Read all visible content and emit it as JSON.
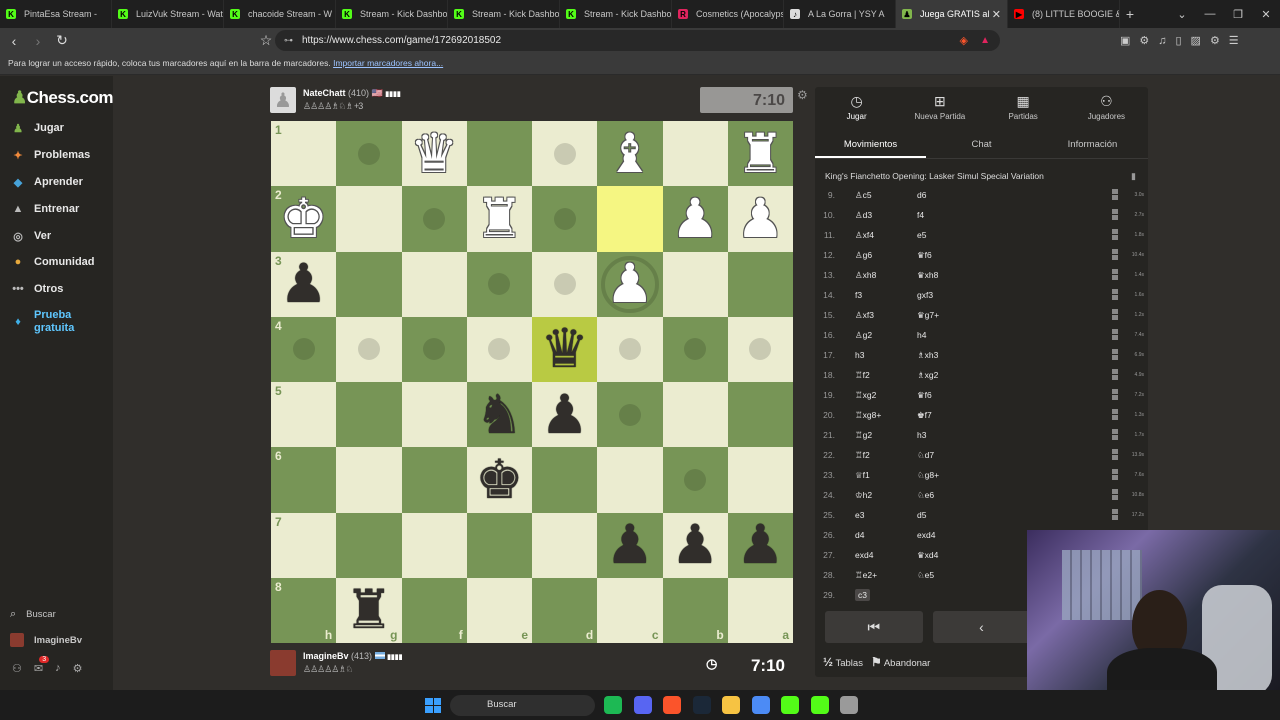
{
  "browser": {
    "tabs": [
      {
        "title": "PintaEsa Stream - ",
        "color": "#53fc18",
        "glyph": "K"
      },
      {
        "title": "LuizVuk Stream - Wat",
        "color": "#53fc18",
        "glyph": "K"
      },
      {
        "title": "chacoide Stream - W",
        "color": "#53fc18",
        "glyph": "K"
      },
      {
        "title": "Stream - Kick Dashbo",
        "color": "#53fc18",
        "glyph": "K"
      },
      {
        "title": "Stream - Kick Dashbo",
        "color": "#53fc18",
        "glyph": "K"
      },
      {
        "title": "Stream - Kick Dashbo",
        "color": "#53fc18",
        "glyph": "K"
      },
      {
        "title": "Cosmetics (Apocalyps",
        "color": "#e0245e",
        "glyph": "R"
      },
      {
        "title": "A La Gorra | YSY A",
        "color": "#dddddd",
        "glyph": "♪"
      },
      {
        "title": "Juega GRATIS al",
        "color": "#81b64c",
        "glyph": "♟",
        "active": true
      },
      {
        "title": "(8) LITTLE BOOGIE &",
        "color": "#ff0000",
        "glyph": "▶"
      }
    ],
    "url": "https://www.chess.com/game/172692018502",
    "bookmarks_text": "Para lograr un acceso rápido, coloca tus marcadores aquí en la barra de marcadores.",
    "bookmarks_link": "Importar marcadores ahora..."
  },
  "sidebar": {
    "logo": "Chess.com",
    "items": [
      {
        "label": "Jugar",
        "icon": "♟",
        "color": "#81b64c"
      },
      {
        "label": "Problemas",
        "icon": "✦",
        "color": "#f08a3c"
      },
      {
        "label": "Aprender",
        "icon": "◆",
        "color": "#47a3d9"
      },
      {
        "label": "Entrenar",
        "icon": "▲",
        "color": "#bbbbbb"
      },
      {
        "label": "Ver",
        "icon": "◎",
        "color": "#bbbbbb"
      },
      {
        "label": "Comunidad",
        "icon": "●",
        "color": "#e7a93c"
      },
      {
        "label": "Otros",
        "icon": "•••",
        "color": "#bbbbbb"
      },
      {
        "label": "Prueba gratuita",
        "icon": "♦",
        "color": "#3fb0e8"
      }
    ],
    "search": "Buscar",
    "user": "ImagineBv",
    "notif_count": "3"
  },
  "game": {
    "top_player": {
      "name": "NateChatt",
      "rating": "(410)",
      "flags": "🇺🇸",
      "captured": "♙♙♙♙♗♘♗ +3",
      "clock": "7:10"
    },
    "bottom_player": {
      "name": "ImagineBv",
      "rating": "(413)",
      "captured": "♙♙♙♙♙♗♘",
      "clock": "7:10"
    },
    "files": [
      "h",
      "g",
      "f",
      "e",
      "d",
      "c",
      "b",
      "a"
    ],
    "ranks": [
      "1",
      "2",
      "3",
      "4",
      "5",
      "6",
      "7",
      "8"
    ],
    "board": [
      [
        "",
        "",
        "wQ",
        "",
        "",
        "wB",
        "",
        "wR"
      ],
      [
        "wK",
        "",
        "",
        "wR",
        "",
        "",
        "wP",
        "wP"
      ],
      [
        "bP",
        "",
        "",
        "",
        "",
        "wP",
        "",
        ""
      ],
      [
        "",
        "",
        "",
        "",
        "bQ",
        "",
        "",
        ""
      ],
      [
        "",
        "",
        "",
        "bN",
        "bP",
        "",
        "",
        ""
      ],
      [
        "",
        "",
        "",
        "bK",
        "",
        "",
        "",
        ""
      ],
      [
        "",
        "",
        "",
        "",
        "",
        "bP",
        "bP",
        "bP"
      ],
      [
        "",
        "bR",
        "",
        "",
        "",
        "",
        "",
        ""
      ]
    ],
    "highlights": [
      [
        1,
        5
      ],
      [
        3,
        4
      ]
    ],
    "dots": [
      [
        0,
        1
      ],
      [
        0,
        4
      ],
      [
        1,
        2
      ],
      [
        1,
        4
      ],
      [
        2,
        3
      ],
      [
        2,
        4
      ],
      [
        3,
        0
      ],
      [
        3,
        1
      ],
      [
        3,
        2
      ],
      [
        3,
        3
      ],
      [
        3,
        5
      ],
      [
        3,
        6
      ],
      [
        3,
        7
      ],
      [
        4,
        5
      ],
      [
        5,
        6
      ]
    ],
    "rings": [
      [
        2,
        5
      ]
    ]
  },
  "panel": {
    "tabs": [
      {
        "label": "Jugar",
        "icon": "◷",
        "active": true
      },
      {
        "label": "Nueva Partida",
        "icon": "⊞"
      },
      {
        "label": "Partidas",
        "icon": "▦"
      },
      {
        "label": "Jugadores",
        "icon": "⚇"
      }
    ],
    "subtabs": [
      {
        "label": "Movimientos",
        "active": true
      },
      {
        "label": "Chat"
      },
      {
        "label": "Información"
      }
    ],
    "opening": "King's Fianchetto Opening: Lasker Simul Special Variation",
    "moves": [
      {
        "n": "9.",
        "w": "♙c5",
        "b": "d6",
        "tw": "3.0s"
      },
      {
        "n": "10.",
        "w": "♙d3",
        "b": "f4",
        "tw": "2.7s"
      },
      {
        "n": "11.",
        "w": "♙xf4",
        "b": "e5",
        "tw": "1.8s"
      },
      {
        "n": "12.",
        "w": "♙g6",
        "b": "♛f6",
        "tw": "10.4s"
      },
      {
        "n": "13.",
        "w": "♙xh8",
        "b": "♛xh8",
        "tw": "1.4s"
      },
      {
        "n": "14.",
        "w": "f3",
        "b": "gxf3",
        "tw": "1.6s"
      },
      {
        "n": "15.",
        "w": "♙xf3",
        "b": "♛g7+",
        "tw": "1.2s"
      },
      {
        "n": "16.",
        "w": "♙g2",
        "b": "h4",
        "tw": "7.4s"
      },
      {
        "n": "17.",
        "w": "h3",
        "b": "♗xh3",
        "tw": "6.9s"
      },
      {
        "n": "18.",
        "w": "♖f2",
        "b": "♗xg2",
        "tw": "4.9s"
      },
      {
        "n": "19.",
        "w": "♖xg2",
        "b": "♛f6",
        "tw": "7.2s"
      },
      {
        "n": "20.",
        "w": "♖xg8+",
        "b": "♚f7",
        "tw": "1.3s"
      },
      {
        "n": "21.",
        "w": "♖g2",
        "b": "h3",
        "tw": "1.7s"
      },
      {
        "n": "22.",
        "w": "♖f2",
        "b": "♘d7",
        "tw": "13.9s"
      },
      {
        "n": "23.",
        "w": "♕f1",
        "b": "♘g8+",
        "tw": "7.6s"
      },
      {
        "n": "24.",
        "w": "♔h2",
        "b": "♘e6",
        "tw": "10.8s"
      },
      {
        "n": "25.",
        "w": "e3",
        "b": "d5",
        "tw": "17.2s"
      },
      {
        "n": "26.",
        "w": "d4",
        "b": "exd4",
        "tw": ""
      },
      {
        "n": "27.",
        "w": "exd4",
        "b": "♛xd4",
        "tw": ""
      },
      {
        "n": "28.",
        "w": "♖e2+",
        "b": "♘e5",
        "tw": ""
      },
      {
        "n": "29.",
        "w": "c3",
        "b": "",
        "tw": "",
        "current": true
      }
    ],
    "controls": [
      "⏮",
      "‹",
      "▶"
    ],
    "draw": "Tablas",
    "draw_icon": "½",
    "resign": "Abandonar",
    "resign_icon": "⚑"
  },
  "taskbar": {
    "search": "Buscar",
    "apps": [
      {
        "name": "spotify",
        "color": "#1db954"
      },
      {
        "name": "discord",
        "color": "#5865f2"
      },
      {
        "name": "brave",
        "color": "#fb542b"
      },
      {
        "name": "steam",
        "color": "#1b2838"
      },
      {
        "name": "explorer",
        "color": "#f6c343"
      },
      {
        "name": "chrome",
        "color": "#4c8bf5"
      },
      {
        "name": "media",
        "color": "#53fc18"
      },
      {
        "name": "kick",
        "color": "#53fc18"
      },
      {
        "name": "settings",
        "color": "#9a9a9a"
      }
    ]
  },
  "colors": {
    "light": "#ebecd0",
    "dark": "#779556",
    "highlight": "#f5f682",
    "bg": "#302e2b",
    "panel": "#262522"
  }
}
